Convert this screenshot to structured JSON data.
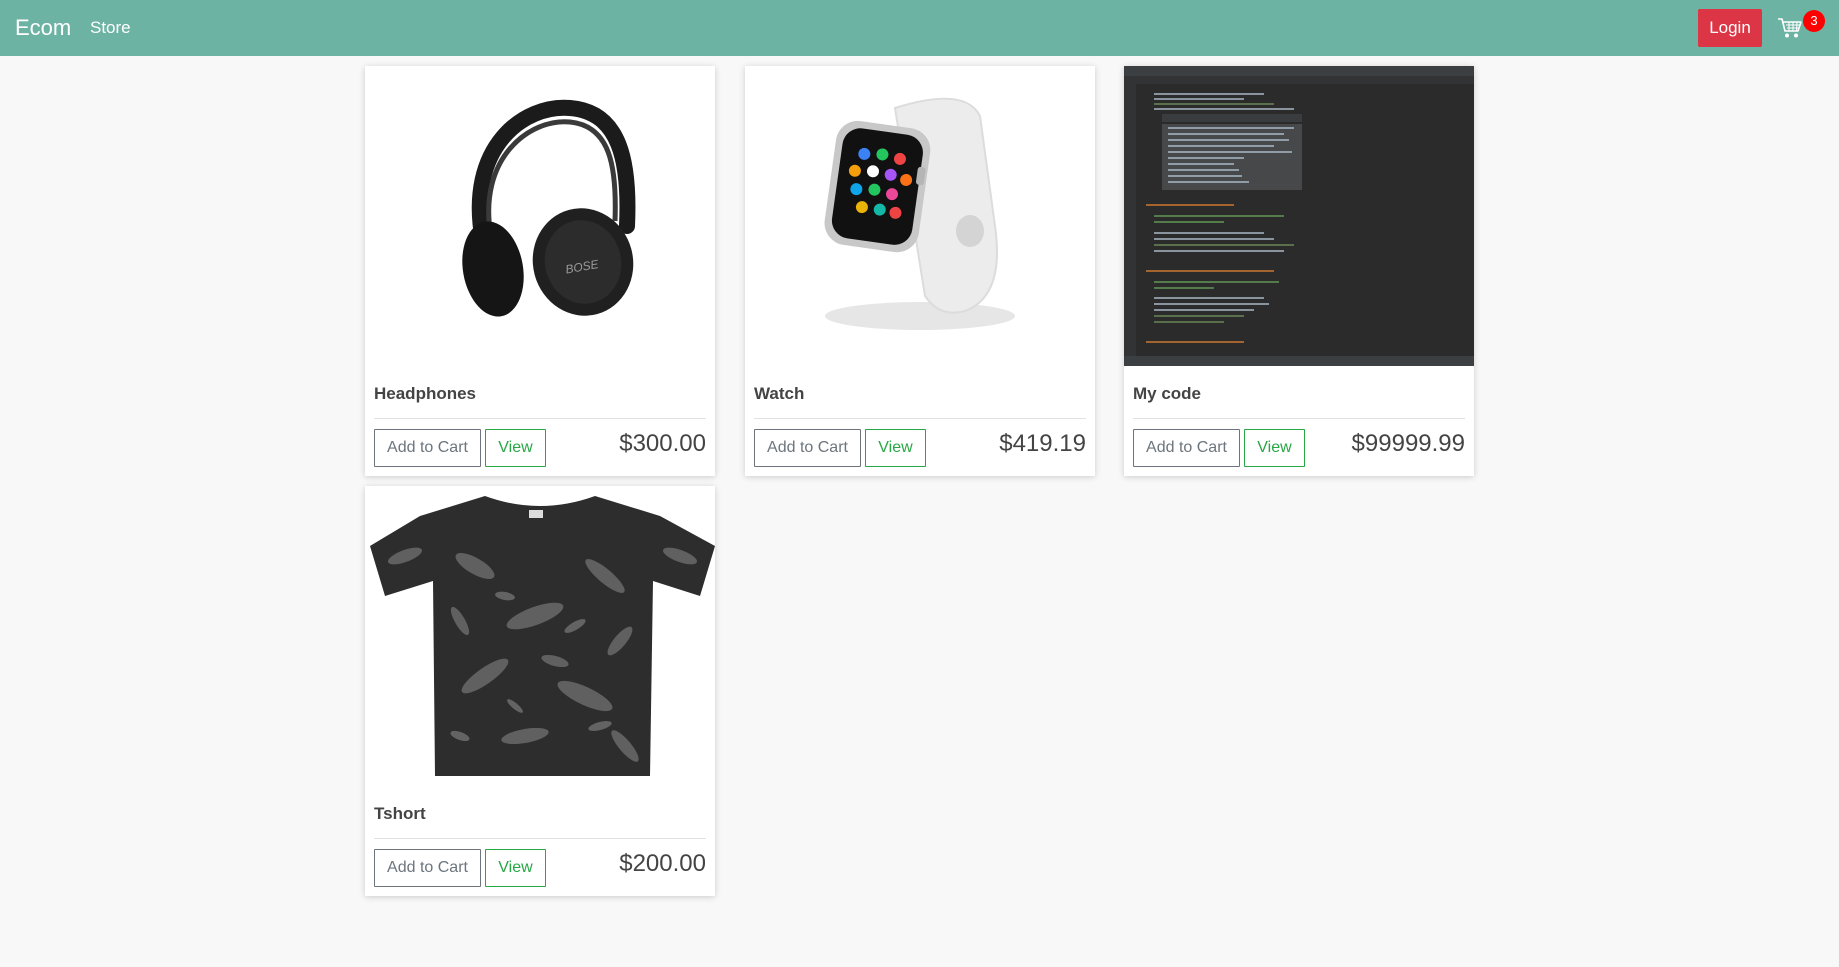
{
  "navbar": {
    "brand": "Ecom",
    "store_link": "Store",
    "login_label": "Login",
    "cart_count": "3",
    "cart_icon": "cart-icon"
  },
  "colors": {
    "navbar_bg": "#6db3a4",
    "login_bg": "#dc3545",
    "badge_bg": "#ff0000",
    "view_green": "#28a745",
    "cart_grey": "#6c757d"
  },
  "products": [
    {
      "name": "Headphones",
      "price": "$300.00",
      "image": "headphones-image",
      "add_label": "Add to Cart",
      "view_label": "View"
    },
    {
      "name": "Watch",
      "price": "$419.19",
      "image": "watch-image",
      "add_label": "Add to Cart",
      "view_label": "View"
    },
    {
      "name": "My code",
      "price": "$99999.99",
      "image": "code-screenshot-image",
      "add_label": "Add to Cart",
      "view_label": "View"
    },
    {
      "name": "Tshort",
      "price": "$200.00",
      "image": "tshirt-image",
      "add_label": "Add to Cart",
      "view_label": "View"
    }
  ]
}
